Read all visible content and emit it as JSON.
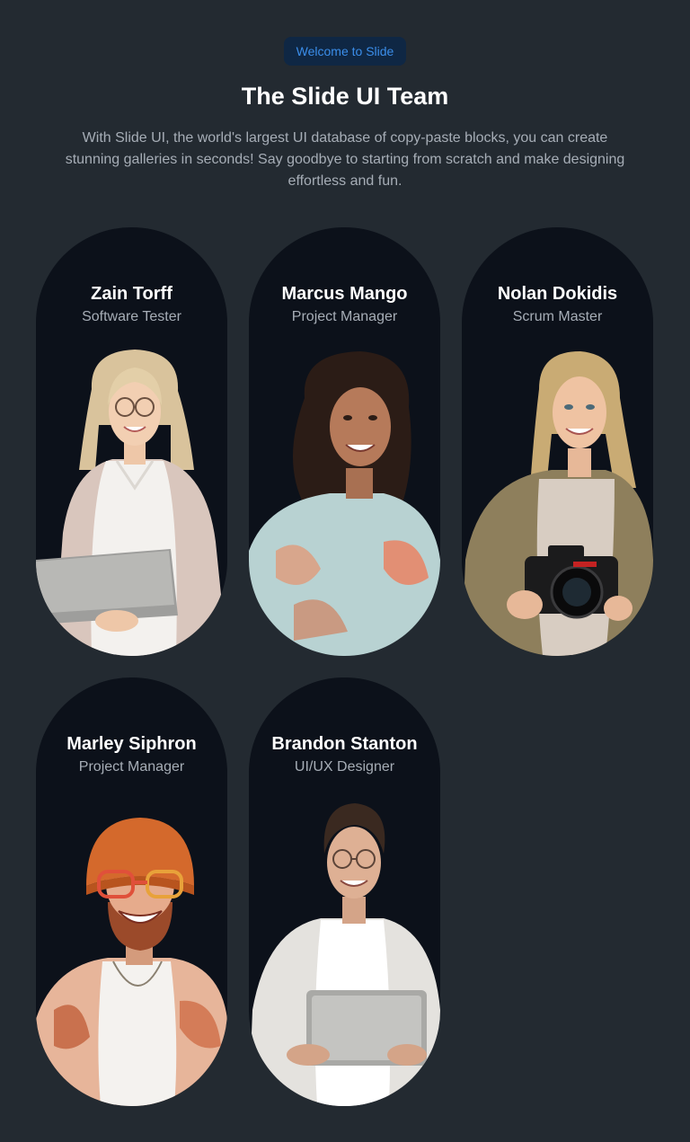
{
  "header": {
    "badge": "Welcome to Slide",
    "title": "The Slide UI Team",
    "description": "With Slide UI, the world's largest UI database of copy-paste blocks, you can create stunning galleries in seconds! Say goodbye to starting from scratch and make designing effortless and fun."
  },
  "team": [
    {
      "name": "Zain Torff",
      "role": "Software Tester"
    },
    {
      "name": "Marcus Mango",
      "role": "Project Manager"
    },
    {
      "name": "Nolan Dokidis",
      "role": "Scrum Master"
    },
    {
      "name": "Marley Siphron",
      "role": "Project Manager"
    },
    {
      "name": "Brandon Stanton",
      "role": "UI/UX Designer"
    }
  ],
  "colors": {
    "background": "#232a31",
    "card": "#0c111a",
    "badge_bg": "#0f2744",
    "badge_text": "#3b8eea"
  }
}
